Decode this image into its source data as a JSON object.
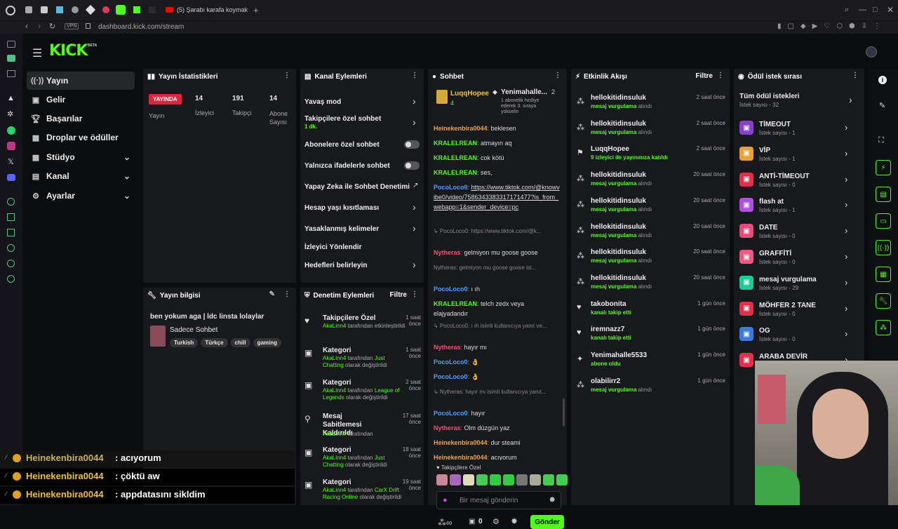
{
  "browser": {
    "tab_title": "(5) Şarabı karafa koymak",
    "url": "dashboard.kick.com/stream",
    "vpn": "VPN"
  },
  "nav": {
    "logo": "KICK",
    "beta": "BETA",
    "items": [
      {
        "label": "Yayın",
        "icon": "antenna-icon"
      },
      {
        "label": "Gelir",
        "icon": "money-icon"
      },
      {
        "label": "Başarılar",
        "icon": "trophy-icon"
      },
      {
        "label": "Droplar ve ödüller",
        "icon": "gift-icon"
      },
      {
        "label": "Stüdyo",
        "icon": "grid-icon"
      },
      {
        "label": "Kanal",
        "icon": "channel-icon"
      },
      {
        "label": "Ayarlar",
        "icon": "gear-icon"
      }
    ]
  },
  "stats": {
    "title": "Yayın İstatistikleri",
    "live": "YAYINDA",
    "live_label": "Yayın",
    "viewers": "14",
    "viewers_label": "İzleyici",
    "followers": "191",
    "followers_label": "Takipçi",
    "subs": "14",
    "subs_label": "Abone Sayısı"
  },
  "info": {
    "title": "Yayın bilgisi",
    "stream_title": "ben yokum aga | ldc linsta lolaylar",
    "category": "Sadece Sohbet",
    "tags": [
      "Turkish",
      "Türkçe",
      "chill",
      "gaming"
    ]
  },
  "actions": {
    "title": "Kanal Eylemleri",
    "items": [
      {
        "label": "Yavaş mod",
        "sub": "",
        "control": "chevron"
      },
      {
        "label": "Takipçilere özel sohbet",
        "sub": "1 dk.",
        "control": "chevron"
      },
      {
        "label": "Abonelere özel sohbet",
        "sub": "",
        "control": "toggle"
      },
      {
        "label": "Yalnızca ifadelerle sohbet",
        "sub": "",
        "control": "toggle"
      },
      {
        "label": "Yapay Zeka ile Sohbet Denetimi",
        "sub": "",
        "control": "link"
      },
      {
        "label": "Hesap yaşı kısıtlaması",
        "sub": "",
        "control": "chevron"
      },
      {
        "label": "Yasaklanmış kelimeler",
        "sub": "",
        "control": "chevron"
      },
      {
        "label": "İzleyici Yönlendir",
        "sub": "",
        "control": "none"
      },
      {
        "label": "Hedefleri belirleyin",
        "sub": "",
        "control": "chevron"
      }
    ]
  },
  "modlog": {
    "title": "Denetim Eylemleri",
    "filter": "Filtre",
    "items": [
      {
        "title": "Takipçilere Özel",
        "time": "1 saat önce",
        "user": "AkaLinn4",
        "desc": "tarafından etkinleştirildi",
        "highlight": ""
      },
      {
        "title": "Kategori",
        "time": "1 saat önce",
        "user": "AkaLinn4",
        "desc": "tarafından",
        "highlight": "Just Chatting",
        "tail": "olarak değiştirildi"
      },
      {
        "title": "Kategori",
        "time": "2 saat önce",
        "user": "AkaLinn4",
        "desc": "tarafından",
        "highlight": "League of Legends",
        "tail": "olarak değiştirildi"
      },
      {
        "title": "Mesaj Sabitlemesi Kaldırıldı",
        "time": "17 saat önce",
        "user": "AkaLinn4",
        "desc": "tarafından",
        "highlight": ""
      },
      {
        "title": "Kategori",
        "time": "18 saat önce",
        "user": "AkaLinn4",
        "desc": "tarafından",
        "highlight": "Just Chatting",
        "tail": "olarak değiştirildi"
      },
      {
        "title": "Kategori",
        "time": "19 saat önce",
        "user": "AkaLinn4",
        "desc": "tarafından",
        "highlight": "CarX Drift Racing Online",
        "tail": "olarak değiştirildi"
      }
    ]
  },
  "chat": {
    "title": "Sohbet",
    "pinned_user": "LuqqHopee",
    "pinned_count": "4",
    "gift_user": "Yenimahalle...",
    "gift_count": "2",
    "gift_text": "1 abonelik hediye ederek 3. sıraya yükselin",
    "messages": [
      {
        "user": "Heinekenbira0044",
        "color": "#f0a04b",
        "text": "beklesen"
      },
      {
        "user": "KRALELREAN",
        "color": "#53fc18",
        "text": "atmayın aq"
      },
      {
        "user": "KRALELREAN",
        "color": "#53fc18",
        "text": "cok kötü"
      },
      {
        "user": "KRALELREAN",
        "color": "#53fc18",
        "text": "ses,"
      },
      {
        "user": "PocoLoco0",
        "color": "#4fa3ff",
        "text": "https://www.tiktok.com/@knowvibe0/video/7586343383317171477?is_from_webapp=1&sender_device=pc"
      },
      {
        "user": "",
        "color": "#888",
        "text": "↳ PocoLoco0: https://www.tiktok.com/@k..."
      },
      {
        "user": "Nytheras",
        "color": "#ff4d6d",
        "text": "gelmiyon mu goose goose"
      },
      {
        "user": "",
        "color": "#888",
        "text": "Nytheras: gelmiyon mu goose goose isi..."
      },
      {
        "user": "PocoLoco0",
        "color": "#4fa3ff",
        "text": "ı ıh"
      },
      {
        "user": "KRALELREAN",
        "color": "#53fc18",
        "text": "telch zedx veya elajyadandır"
      },
      {
        "user": "",
        "color": "#888",
        "text": "↳ PocoLoco0: ı ıh isimli kullanıcıya yanıt ve..."
      },
      {
        "user": "Nytheras",
        "color": "#ff4d6d",
        "text": "hayır mı"
      },
      {
        "user": "PocoLoco0",
        "color": "#4fa3ff",
        "text": "👌"
      },
      {
        "user": "PocoLoco0",
        "color": "#4fa3ff",
        "text": "👌"
      },
      {
        "user": "",
        "color": "#888",
        "text": "↳ Nytheras: hayır mı isimli kullanıcıya yanıt..."
      },
      {
        "user": "PocoLoco0",
        "color": "#4fa3ff",
        "text": "hayır"
      },
      {
        "user": "Nytheras",
        "color": "#ff4d6d",
        "text": "Olm düzgün yaz"
      },
      {
        "user": "Heinekenbira0044",
        "color": "#f0a04b",
        "text": "dur steami"
      },
      {
        "user": "Heinekenbira0044",
        "color": "#f0a04b",
        "text": "acıyorum"
      }
    ],
    "followers_only": "Takipçilere Özel",
    "placeholder": "Bir mesaj gönderin",
    "send": "Gönder",
    "points": "0"
  },
  "activity": {
    "title": "Etkinlik Akışı",
    "filter": "Filtre",
    "items": [
      {
        "name": "hellokitidinsuluk",
        "sub": "mesaj vurgulama",
        "sub2": "alındı",
        "time": "2 saat önce",
        "icon": "gift-icon"
      },
      {
        "name": "hellokitidinsuluk",
        "sub": "mesaj vurgulama",
        "sub2": "alındı",
        "time": "2 saat önce",
        "icon": "gift-icon"
      },
      {
        "name": "LuqqHopee",
        "sub": "9 izleyici ile yayınınıza katıldı",
        "sub2": "",
        "time": "2 saat önce",
        "icon": "raid-icon"
      },
      {
        "name": "hellokitidinsuluk",
        "sub": "mesaj vurgulama",
        "sub2": "alındı",
        "time": "20 saat önce",
        "icon": "gift-icon"
      },
      {
        "name": "hellokitidinsuluk",
        "sub": "mesaj vurgulama",
        "sub2": "alındı",
        "time": "20 saat önce",
        "icon": "gift-icon"
      },
      {
        "name": "hellokitidinsuluk",
        "sub": "mesaj vurgulama",
        "sub2": "alındı",
        "time": "20 saat önce",
        "icon": "gift-icon"
      },
      {
        "name": "hellokitidinsuluk",
        "sub": "mesaj vurgulama",
        "sub2": "alındı",
        "time": "20 saat önce",
        "icon": "gift-icon"
      },
      {
        "name": "hellokitidinsuluk",
        "sub": "mesaj vurgulama",
        "sub2": "alındı",
        "time": "20 saat önce",
        "icon": "gift-icon"
      },
      {
        "name": "takobonita",
        "sub": "kanalı takip etti",
        "sub2": "",
        "time": "1 gün önce",
        "icon": "heart-icon"
      },
      {
        "name": "iremnazz7",
        "sub": "kanalı takip etti",
        "sub2": "",
        "time": "1 gün önce",
        "icon": "heart-icon"
      },
      {
        "name": "Yenimahalle5533",
        "sub": "abone oldu",
        "sub2": "",
        "time": "1 gün önce",
        "icon": "star-icon"
      },
      {
        "name": "olabilirr2",
        "sub": "mesaj vurgulama",
        "sub2": "alındı",
        "time": "1 gün önce",
        "icon": "gift-icon"
      }
    ]
  },
  "rewards": {
    "title": "Ödül istek sırası",
    "all": "Tüm ödül istekleri",
    "all_count": "İstek sayısı - 32",
    "items": [
      {
        "name": "TİMEOUT",
        "count": "İstek sayısı - 1",
        "color": "#8b3fd1"
      },
      {
        "name": "VİP",
        "count": "İstek sayısı - 1",
        "color": "#f0a030"
      },
      {
        "name": "ANTİ-TİMEOUT",
        "count": "İstek sayısı - 0",
        "color": "#e0304a"
      },
      {
        "name": "flash at",
        "count": "İstek sayısı - 1",
        "color": "#b04fe0"
      },
      {
        "name": "DATE",
        "count": "İstek sayısı - 0",
        "color": "#e84a7a"
      },
      {
        "name": "GRAFFİTİ",
        "count": "İstek sayısı - 0",
        "color": "#e85a80"
      },
      {
        "name": "mesaj vurgulama",
        "count": "İstek sayısı - 29",
        "color": "#20c997"
      },
      {
        "name": "MÖHFER 2 TANE",
        "count": "İstek sayısı - 0",
        "color": "#e0304a"
      },
      {
        "name": "OG",
        "count": "İstek sayısı - 0",
        "color": "#3a7be0"
      },
      {
        "name": "ARABA DEVİR",
        "count": "",
        "color": "#e0304a"
      }
    ]
  },
  "overlay_chat": [
    {
      "user": "Heinekenbira0044",
      "text": ": acıyorum"
    },
    {
      "user": "Heinekenbira0044",
      "text": ": çöktü aw"
    },
    {
      "user": "Heinekenbira0044",
      "text": ": appdatasını sikldim"
    }
  ],
  "colors": {
    "accent": "#53fc18",
    "bg": "#0b0c0e",
    "panel": "#18191c"
  }
}
